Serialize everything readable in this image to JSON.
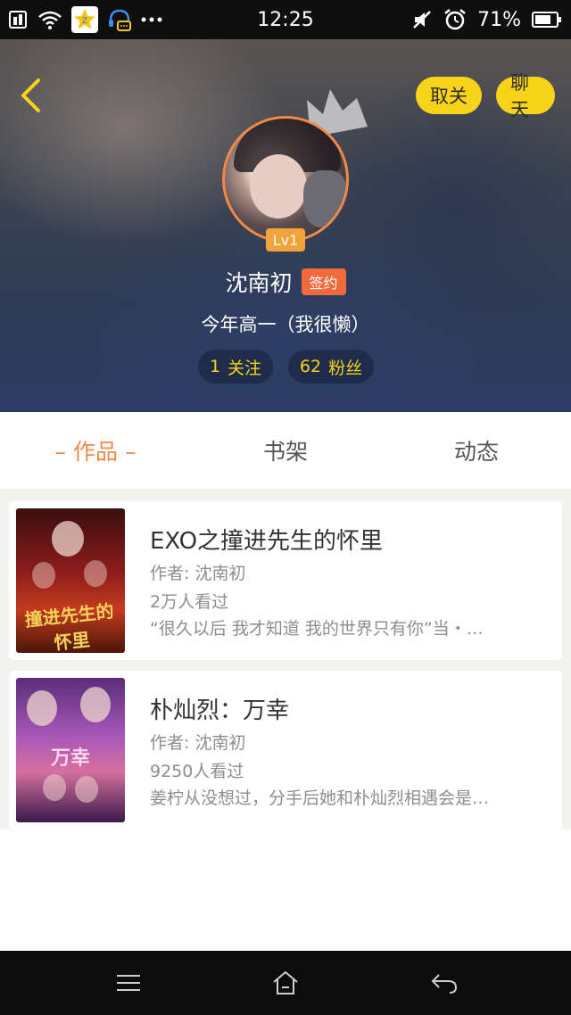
{
  "status_bar": {
    "time": "12:25",
    "battery": "71%",
    "left_icons": [
      "sim-icon",
      "wifi-icon",
      "qq-app-icon",
      "headset-chat-icon",
      "more-dots-icon"
    ],
    "right_icons": [
      "mute-icon",
      "alarm-icon",
      "battery-icon"
    ]
  },
  "header": {
    "back_icon": "chevron-left-icon",
    "unfollow_label": "取关",
    "chat_label": "聊天",
    "level": "Lv1",
    "username": "沈南初",
    "signed_label": "签约",
    "bio": "今年高一（我很懒）",
    "following_count": "1",
    "following_label": "关注",
    "fans_count": "62",
    "fans_label": "粉丝"
  },
  "tabs": [
    {
      "label": "– 作品 –",
      "active": true
    },
    {
      "label": "书架",
      "active": false
    },
    {
      "label": "动态",
      "active": false
    }
  ],
  "books": [
    {
      "title": "EXO之撞进先生的怀里",
      "author": "作者: 沈南初",
      "views": "2万人看过",
      "description": "“很久以后 我才知道 我的世界只有你”当・…",
      "cover_text": "撞进先生的怀里"
    },
    {
      "title": "朴灿烈：万幸",
      "author": "作者: 沈南初",
      "views": "9250人看过",
      "description": "姜柠从没想过，分手后她和朴灿烈相遇会是…",
      "cover_text": "万幸"
    }
  ],
  "nav_bar": {
    "icons": [
      "menu-icon",
      "home-icon",
      "back-arrow-icon"
    ]
  },
  "colors": {
    "accent_yellow": "#f8d31a",
    "tab_active": "#f08a4b",
    "signed_badge": "#f06a3e",
    "level_badge": "#f2a33a"
  }
}
